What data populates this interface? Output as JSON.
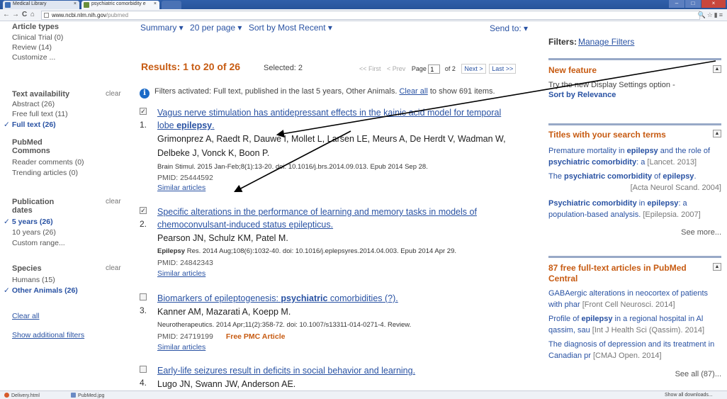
{
  "browser": {
    "tabs": [
      {
        "label": "Medical Library"
      },
      {
        "label": "psychiatric comorbidity e"
      },
      {
        "label": ""
      }
    ],
    "url_host": "www.ncbi.nlm.nih.gov",
    "url_path": "/pubmed",
    "back": "←",
    "forward": "→",
    "reload": "C",
    "home": "⌂"
  },
  "sidebar": {
    "article_types": "Article types",
    "clinical_trial": "Clinical Trial (0)",
    "review": "Review (14)",
    "customize": "Customize ...",
    "text_availability": "Text availability",
    "clear": "clear",
    "abstract": "Abstract (26)",
    "free_full_text": "Free full text (11)",
    "full_text": "Full text (26)",
    "pubmed_commons_1": "PubMed",
    "pubmed_commons_2": "Commons",
    "reader_comments": "Reader comments (0)",
    "trending": "Trending articles (0)",
    "pub_dates_1": "Publication",
    "pub_dates_2": "dates",
    "five_years": "5 years (26)",
    "ten_years": "10 years (26)",
    "custom_range": "Custom range...",
    "species": "Species",
    "humans": "Humans (15)",
    "other_animals": "Other Animals (26)",
    "clear_all": "Clear all",
    "show_filters": "Show additional filters",
    "check": "✓"
  },
  "toolbar": {
    "summary": "Summary ▾",
    "per_page": "20 per page ▾",
    "sort": "Sort by Most Recent ▾",
    "send_to": "Send to: ▾"
  },
  "results": {
    "heading": "Results: 1 to 20 of 26",
    "selected": "Selected: 2",
    "first": "<< First",
    "prev": "< Prev",
    "page_label": "Page",
    "page_value": "1",
    "of": "of 2",
    "next": "Next >",
    "last": "Last >>"
  },
  "filter_msg": {
    "text": "Filters activated: Full text, published in the last 5 years, Other Animals.",
    "clear_link": "Clear all",
    "suffix": "to show 691 items."
  },
  "items": [
    {
      "num": "1.",
      "checked": "✓",
      "title_a": "Vagus nerve stimulation has antidepressant effects in the kainic acid model for temporal lobe ",
      "title_b": "epilepsy",
      "title_c": ".",
      "authors": "Grimonprez A, Raedt R, Dauwe I, Mollet L, Larsen LE, Meurs A, De Herdt V, Wadman W, Delbeke J, Vonck K, Boon P.",
      "cite": "Brain Stimul. 2015 Jan-Feb;8(1):13-20. doi: 10.1016/j.brs.2014.09.013. Epub 2014 Sep 28.",
      "pmid": "PMID: 25444592",
      "similar": "Similar articles"
    },
    {
      "num": "2.",
      "checked": "✓",
      "title_a": "Specific alterations in the performance of learning and memory tasks in models of chemoconvulsant-induced status epilepticus.",
      "authors": "Pearson JN, Schulz KM, Patel M.",
      "cite_b": "Epilepsy",
      "cite": " Res. 2014 Aug;108(6):1032-40. doi: 10.1016/j.eplepsyres.2014.04.003. Epub 2014 Apr 29.",
      "pmid": "PMID: 24842343",
      "similar": "Similar articles"
    },
    {
      "num": "3.",
      "checked": "",
      "title_a": "Biomarkers of epileptogenesis: ",
      "title_b": "psychiatric",
      "title_c": " comorbidities (?).",
      "authors": "Kanner AM, Mazarati A, Koepp M.",
      "cite": "Neurotherapeutics. 2014 Apr;11(2):358-72. doi: 10.1007/s13311-014-0271-4. Review.",
      "pmid": "PMID: 24719199",
      "free": "Free PMC Article",
      "similar": "Similar articles"
    },
    {
      "num": "4.",
      "checked": "",
      "title_a": "Early-life seizures result in deficits in social behavior and learning.",
      "authors": "Lugo JN, Swann JW, Anderson AE."
    }
  ],
  "right": {
    "filters_label": "Filters:",
    "manage_filters": "Manage Filters",
    "new_feature_title": "New feature",
    "new_feature_text": "Try the new Display Settings option -",
    "new_feature_link": "Sort by Relevance",
    "titles_title": "Titles with your search terms",
    "toggle": "▲",
    "t1_a": "Premature mortality in ",
    "t1_b": "epilepsy",
    "t1_c": " and the role of ",
    "t1_d": "psychiatric comorbidity",
    "t1_e": ": a",
    "t1_ref": "[Lancet. 2013]",
    "t2_a": "The ",
    "t2_b": "psychiatric comorbidity",
    "t2_c": " of ",
    "t2_d": "epilepsy",
    "t2_e": ".",
    "t2_ref": "[Acta Neurol Scand. 2004]",
    "t3_a": "Psychiatric comorbidity",
    "t3_b": " in ",
    "t3_c": "epilepsy",
    "t3_d": ": a population-based analysis.",
    "t3_ref": "[Epilepsia. 2007]",
    "see_more": "See more...",
    "free_title": "87 free full-text articles in PubMed Central",
    "f1": "GABAergic alterations in neocortex of patients with phar",
    "f1_ref": "[Front Cell Neurosci. 2014]",
    "f2_a": "Profile of ",
    "f2_b": "epilepsy",
    "f2_c": " in a regional hospital in Al qassim, sau",
    "f2_ref": "[Int J Health Sci (Qassim). 2014]",
    "f3": "The diagnosis of depression and its treatment in Canadian pr",
    "f3_ref": "[CMAJ Open. 2014]",
    "see_all": "See all (87)..."
  },
  "downloads": {
    "item1": "Delivery.html",
    "item2": "PubMed.jpg",
    "show_all": "Show all downloads..."
  }
}
